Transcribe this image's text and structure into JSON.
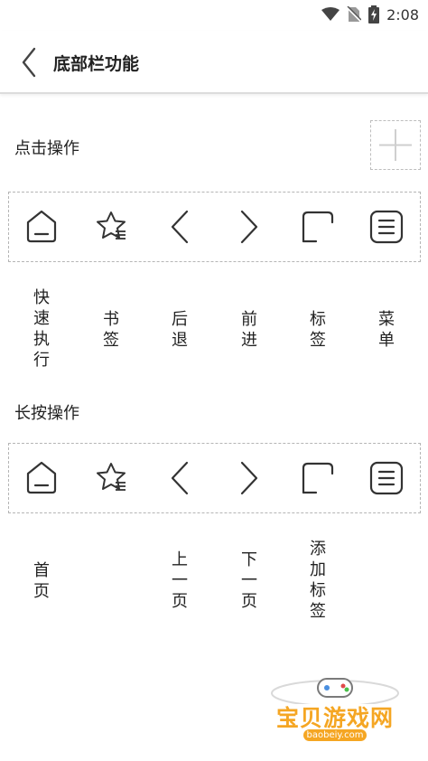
{
  "status_bar": {
    "time": "2:08",
    "icons": [
      "wifi-icon",
      "no-sim-icon",
      "battery-charging-icon"
    ]
  },
  "header": {
    "title": "底部栏功能",
    "back_icon": "back-chevron-icon"
  },
  "click_section": {
    "title": "点击操作",
    "add_icon": "plus-icon",
    "items": [
      {
        "icon": "home-icon",
        "label": "快速执行"
      },
      {
        "icon": "star-bookmark-icon",
        "label": "书签"
      },
      {
        "icon": "chevron-left-icon",
        "label": "后退"
      },
      {
        "icon": "chevron-right-icon",
        "label": "前进"
      },
      {
        "icon": "tab-icon",
        "label": "标签"
      },
      {
        "icon": "menu-icon",
        "label": "菜单"
      }
    ]
  },
  "long_press_section": {
    "title": "长按操作",
    "items": [
      {
        "icon": "home-icon",
        "label": "首页"
      },
      {
        "icon": "star-bookmark-icon",
        "label": ""
      },
      {
        "icon": "chevron-left-icon",
        "label": "上一页"
      },
      {
        "icon": "chevron-right-icon",
        "label": "下一页"
      },
      {
        "icon": "tab-icon",
        "label": "添加标签"
      },
      {
        "icon": "menu-icon",
        "label": ""
      }
    ]
  },
  "watermark": {
    "name": "宝贝游戏网",
    "domain": "baobeiy.com"
  },
  "colors": {
    "icon_stroke": "#333333",
    "dashed_border": "#b5b5b5",
    "watermark": "#f5a623"
  }
}
